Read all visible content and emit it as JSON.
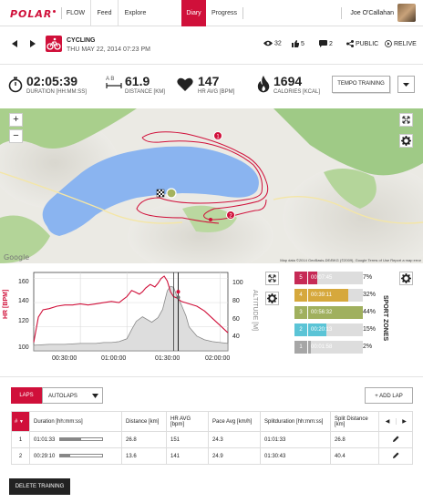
{
  "nav": {
    "logo": "POLAR",
    "flow": "FLOW",
    "items": [
      "Feed",
      "Explore",
      "Diary",
      "Progress"
    ],
    "active": "Diary",
    "user": "Joe O'Callahan"
  },
  "session": {
    "sport": "CYCLING",
    "date": "THU MAY 22, 2014 07:23 PM",
    "views": "32",
    "likes": "5",
    "comments": "2",
    "visibility": "PUBLIC",
    "relive": "RELIVE"
  },
  "stats": {
    "duration": {
      "value": "02:05:39",
      "label": "DURATION [HH:MM:SS]"
    },
    "distance": {
      "value": "61.9",
      "label": "DISTANCE [KM]",
      "ab": "A  B"
    },
    "hr": {
      "value": "147",
      "label": "HR AVG [BPM]"
    },
    "calories": {
      "value": "1694",
      "label": "CALORIES [KCAL]"
    },
    "training": "TEMPO TRAINING"
  },
  "map": {
    "zoom_in": "+",
    "zoom_out": "−",
    "marker1": "1",
    "marker2": "2",
    "attribution": "Map data ©2014 GeoBasis-DE/BKG (©2009), Google   Terms of Use   Report a map error",
    "google": "Google"
  },
  "chart_data": {
    "type": "line",
    "xlabel": "",
    "x_ticks": [
      "00:30:00",
      "01:00:00",
      "01:30:00",
      "02:00:00"
    ],
    "ylabel": "HR [BPM]",
    "y_ticks": [
      "100",
      "120",
      "140",
      "160"
    ],
    "ylim": [
      100,
      165
    ],
    "y2label": "ALTITUDE [M]",
    "y2_ticks": [
      "40",
      "60",
      "80",
      "100"
    ],
    "y2lim": [
      30,
      115
    ],
    "series": [
      {
        "name": "HR [BPM]",
        "color": "#d0103a",
        "x": [
          0,
          3,
          6,
          10,
          15,
          20,
          25,
          30,
          35,
          40,
          45,
          50,
          55,
          58,
          60,
          63,
          65,
          68,
          70,
          72,
          75,
          78,
          80,
          82,
          84,
          86,
          88,
          90,
          92,
          95,
          100,
          105,
          110,
          115,
          120,
          125
        ],
        "y": [
          107,
          128,
          134,
          135,
          137,
          138,
          138,
          139,
          138,
          139,
          140,
          141,
          140,
          143,
          145,
          150,
          149,
          147,
          149,
          152,
          155,
          153,
          156,
          160,
          162,
          158,
          149,
          145,
          144,
          141,
          139,
          137,
          133,
          127,
          121,
          115
        ]
      },
      {
        "name": "ALTITUDE [M]",
        "color": "#999999",
        "x": [
          0,
          10,
          20,
          30,
          40,
          45,
          50,
          55,
          60,
          63,
          66,
          70,
          73,
          76,
          80,
          83,
          86,
          88,
          90,
          92,
          95,
          98,
          100,
          105,
          110,
          115,
          120,
          125
        ],
        "y": [
          36,
          37,
          37,
          38,
          38,
          39,
          39,
          40,
          43,
          53,
          62,
          67,
          64,
          61,
          66,
          75,
          95,
          100,
          99,
          90,
          80,
          68,
          56,
          46,
          42,
          40,
          39,
          38
        ]
      }
    ],
    "markers_x": [
      "01:00:00",
      "01:30:00"
    ]
  },
  "zones": {
    "title": "SPORT ZONES",
    "rows": [
      {
        "n": "5",
        "time": "00:07:45",
        "pct": "7%",
        "frac": 0.07,
        "color": "#c62a56"
      },
      {
        "n": "4",
        "time": "00:39:11",
        "pct": "32%",
        "frac": 0.32,
        "color": "#d6a83c"
      },
      {
        "n": "3",
        "time": "00:56:32",
        "pct": "44%",
        "frac": 0.44,
        "color": "#a0b05e"
      },
      {
        "n": "2",
        "time": "00:20:13",
        "pct": "15%",
        "frac": 0.15,
        "color": "#5bc4d6"
      },
      {
        "n": "1",
        "time": "00:01:58",
        "pct": "2%",
        "frac": 0.02,
        "color": "#a6a6a6"
      }
    ]
  },
  "laps": {
    "tab1": "LAPS",
    "tab2": "AUTOLAPS",
    "add": "+ ADD LAP",
    "headers": [
      "#",
      "Duration [hh:mm:ss]",
      "Distance [km]",
      "HR AVG [bpm]",
      "Pace Avg [km/h]",
      "Splitduration [hh:mm:ss]",
      "Split Distance [km]"
    ],
    "rows": [
      {
        "n": "1",
        "duration": "01:01:33",
        "dur_frac": 0.49,
        "distance": "26.8",
        "hr": "151",
        "pace": "24.3",
        "split": "01:01:33",
        "splitdist": "26.8"
      },
      {
        "n": "2",
        "duration": "00:29:10",
        "dur_frac": 0.23,
        "distance": "13.6",
        "hr": "141",
        "pace": "24.9",
        "split": "01:30:43",
        "splitdist": "40.4"
      }
    ]
  },
  "delete": "DELETE TRAINING"
}
